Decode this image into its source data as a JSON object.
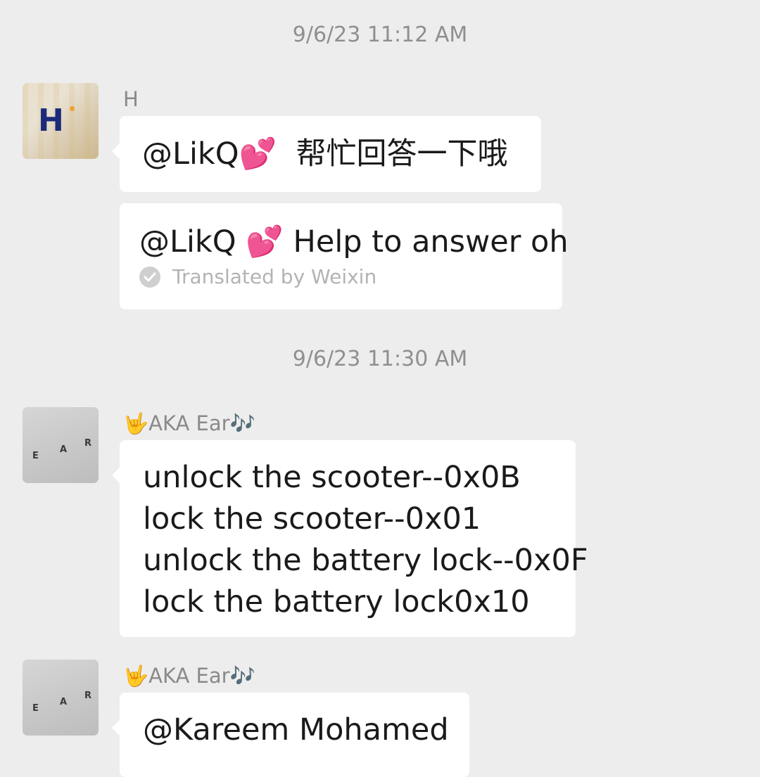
{
  "chat": {
    "timestamps": [
      "9/6/23 11:12 AM",
      "9/6/23 11:30 AM"
    ],
    "messages": [
      {
        "sender": "H",
        "text": "@LikQ💕  帮忙回答一下哦",
        "translation": "@LikQ 💕 Help to answer oh",
        "translated_by": "Translated by Weixin"
      },
      {
        "sender": "🤟AKA Ear🎶",
        "lines": [
          "unlock the scooter--0x0B",
          "lock the scooter--0x01",
          "unlock the battery lock--0x0F",
          "lock the battery lock0x10"
        ]
      },
      {
        "sender": "🤟AKA Ear🎶",
        "text": "@Kareem Mohamed"
      }
    ]
  },
  "avatars": {
    "h": {
      "letter": "H",
      "icon": "h-logo-avatar"
    },
    "ear": {
      "letters": [
        "E",
        "A",
        "R"
      ],
      "icon": "ear-letters-avatar"
    }
  },
  "colors": {
    "background": "#ededed",
    "bubble": "#ffffff",
    "timestamp": "#8f8f8f",
    "sender": "#8a8a8a",
    "translated": "#b3b3b3"
  }
}
